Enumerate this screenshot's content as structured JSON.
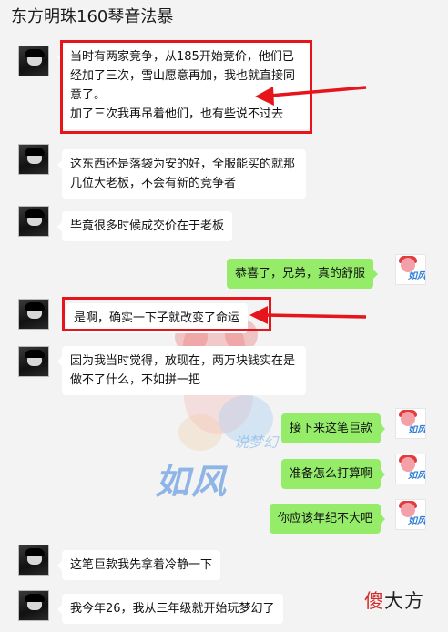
{
  "chat": {
    "title": "东方明珠160琴音法暴",
    "messages": [
      {
        "side": "left",
        "text": "当时有两家竞争，从185开始竞价，他们已经加了三次，雪山愿意再加，我也就直接同意了。\n加了三次我再吊着他们，也有些说不过去"
      },
      {
        "side": "left",
        "text": "这东西还是落袋为安的好，全服能买的就那几位大老板，不会有新的竞争者"
      },
      {
        "side": "left",
        "text": "毕竟很多时候成交价在于老板"
      },
      {
        "side": "right",
        "text": "恭喜了，兄弟，真的舒服"
      },
      {
        "side": "left",
        "text": "是啊，确实一下子就改变了命运"
      },
      {
        "side": "left",
        "text": "因为我当时觉得，放现在，两万块钱实在是做不了什么，不如拼一把"
      },
      {
        "side": "right",
        "text": "接下来这笔巨款"
      },
      {
        "side": "right",
        "text": "准备怎么打算啊"
      },
      {
        "side": "right",
        "text": "你应该年纪不大吧"
      },
      {
        "side": "left",
        "text": "这笔巨款我先拿着冷静一下"
      },
      {
        "side": "left",
        "text": "我今年26，我从三年级就开始玩梦幻了"
      }
    ]
  },
  "watermark": {
    "main": "如风",
    "sub": "说梦幻"
  },
  "brand": {
    "first": "傻",
    "rest": "大方"
  },
  "colors": {
    "highlight": "#e6141b",
    "right_bubble": "#95ec69",
    "left_bubble": "#ffffff"
  }
}
